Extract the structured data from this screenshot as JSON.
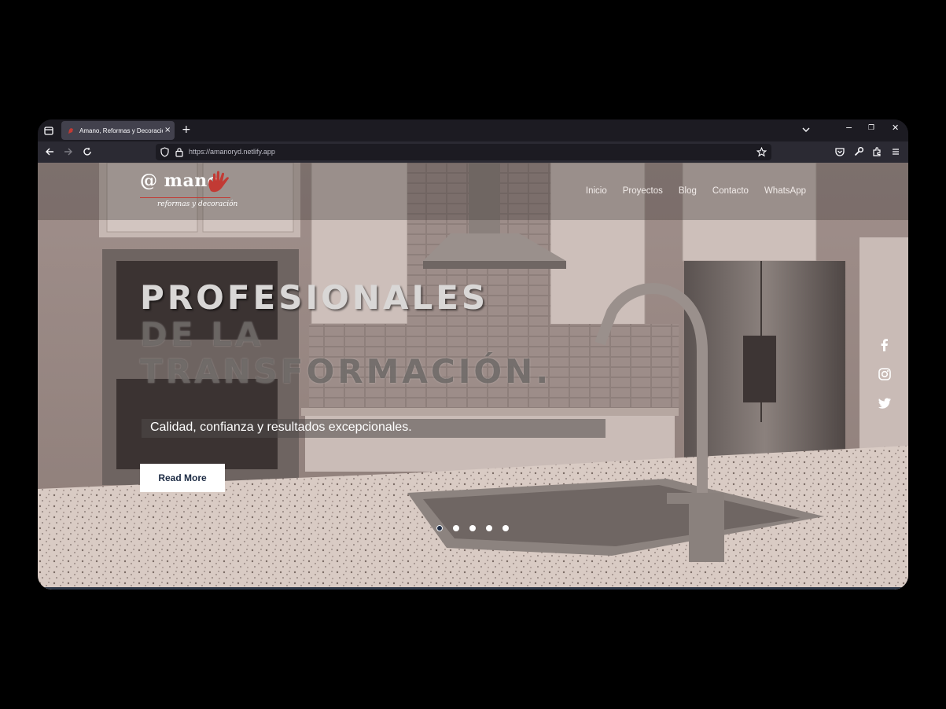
{
  "browser": {
    "tab_title": "Amano, Reformas y Decoración",
    "tab_close": "×",
    "new_tab": "+",
    "url": "https://amanoryd.netlify.app",
    "window_controls": {
      "minimize": "−",
      "restore": "❐",
      "close": "✕"
    },
    "icons": [
      "tab-list-icon",
      "chevron-down-icon",
      "back-icon",
      "forward-icon",
      "reload-icon",
      "shield-icon",
      "lock-icon",
      "star-icon",
      "pocket-icon",
      "wrench-icon",
      "extensions-icon",
      "menu-icon"
    ]
  },
  "site": {
    "logo": {
      "text": "@ mano",
      "tagline": "reformas y decoración",
      "accent": "#c23a34"
    },
    "nav": [
      {
        "label": "Inicio"
      },
      {
        "label": "Proyectos"
      },
      {
        "label": "Blog"
      },
      {
        "label": "Contacto"
      },
      {
        "label": "WhatsApp"
      }
    ],
    "hero": {
      "line1": "PROFESIONALES",
      "line2": "DE LA",
      "line3": "TRANSFORMACIÓN.",
      "subtitle": "Calidad, confianza y resultados excepcionales.",
      "cta": "Read More",
      "slides_total": 5,
      "active_slide": 1
    },
    "social": [
      "facebook-icon",
      "instagram-icon",
      "twitter-icon"
    ],
    "colors": {
      "cta_text": "#1c2b44",
      "nav_text": "#f2ecea"
    }
  }
}
